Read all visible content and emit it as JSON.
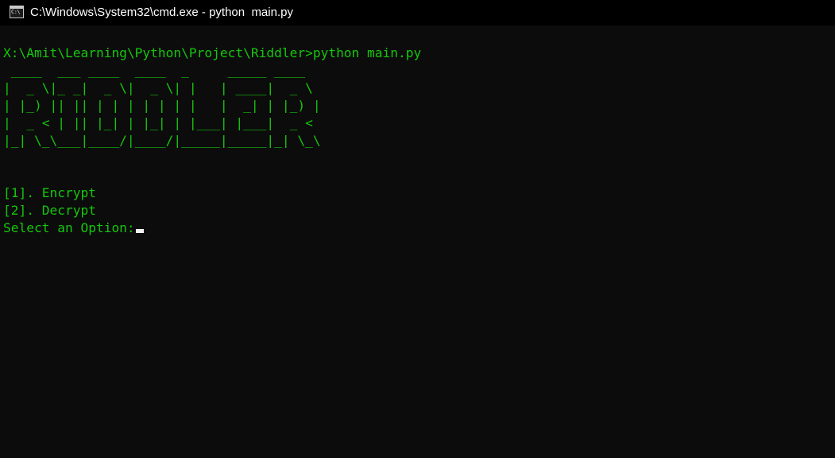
{
  "window": {
    "title": "C:\\Windows\\System32\\cmd.exe - python  main.py",
    "icon": "cmd-icon",
    "icon_text": "C:\\",
    "colors": {
      "titlebar": "#000000",
      "background": "#0c0c0c",
      "text": "#16c60c",
      "cursor": "#f2f2f2"
    }
  },
  "console": {
    "command_line": "X:\\Amit\\Learning\\Python\\Project\\Riddler>python main.py",
    "banner": " ____  ___ ____  ____  _     _____ ____  \n|  _ \\|_ _|  _ \\|  _ \\| |   | ____|  _ \\ \n| |_) || || | | | | | | |   |  _| | |_) |\n|  _ < | || |_| | |_| | |___| |___|  _ < \n|_| \\_\\___|____/|____/|_____|_____|_| \\_\\",
    "menu": [
      "[1]. Encrypt",
      "[2]. Decrypt"
    ],
    "prompt": "Select an Option:"
  }
}
